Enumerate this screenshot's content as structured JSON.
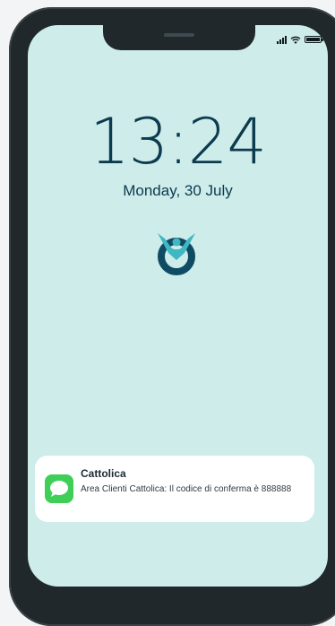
{
  "lock_screen": {
    "time": "13:24",
    "date": "Monday, 30 July",
    "background_color": "#cdecea",
    "logo_icon": "cattolica-logo-icon"
  },
  "status_bar": {
    "icons": [
      "signal-icon",
      "wifi-icon",
      "battery-icon"
    ]
  },
  "notification": {
    "app_icon": "messages-icon",
    "title": "Cattolica",
    "body": "Area Clienti Cattolica: Il codice di conferma è 888888"
  }
}
